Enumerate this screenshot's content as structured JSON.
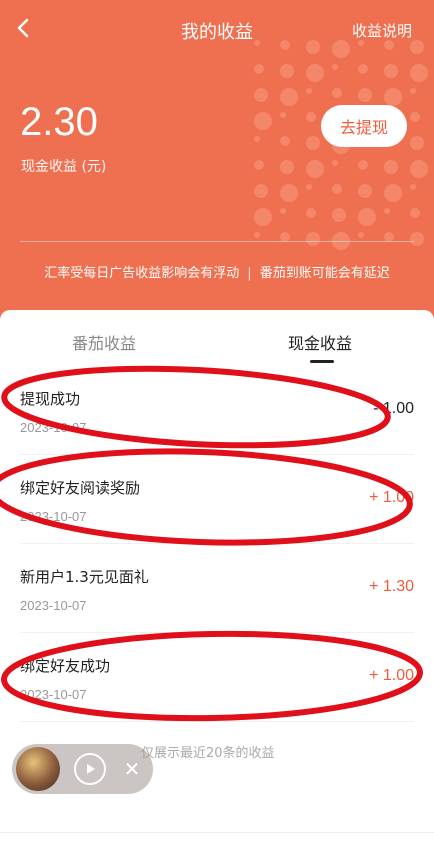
{
  "topbar": {
    "title": "我的收益",
    "explain_label": "收益说明"
  },
  "summary": {
    "amount": "2.30",
    "amount_label": "现金收益 (元)",
    "withdraw_label": "去提现"
  },
  "notice": {
    "left": "汇率受每日广告收益影响会有浮动",
    "right": "番茄到账可能会有延迟"
  },
  "tabs": [
    {
      "label": "番茄收益",
      "active": false
    },
    {
      "label": "现金收益",
      "active": true
    }
  ],
  "records": [
    {
      "title": "提现成功",
      "date": "2023-10-07",
      "amount": "- 1.00"
    },
    {
      "title": "绑定好友阅读奖励",
      "date": "2023-10-07",
      "amount": "+ 1.00"
    },
    {
      "title": "新用户1.3元见面礼",
      "date": "2023-10-07",
      "amount": "+ 1.30"
    },
    {
      "title": "绑定好友成功",
      "date": "2023-10-07",
      "amount": "+ 1.00"
    }
  ],
  "footer_note": "仅展示最近20条的收益",
  "colors": {
    "brand": "#ef7050",
    "accent": "#ef5b3b",
    "annotation": "#e0101a"
  },
  "icons": {
    "back": "chevron-left-icon",
    "play": "play-icon",
    "close": "close-icon"
  }
}
